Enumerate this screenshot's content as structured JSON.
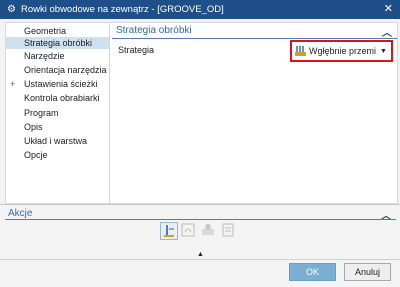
{
  "window": {
    "title": "Rowki obwodowe na zewnątrz - [GROOVE_OD]"
  },
  "tree": {
    "items": [
      {
        "label": "Geometria",
        "selected": false,
        "expandable": false
      },
      {
        "label": "Strategia obróbki",
        "selected": true,
        "expandable": false
      },
      {
        "label": "Narzędzie",
        "selected": false,
        "expandable": false
      },
      {
        "label": "Orientacja narzędzia",
        "selected": false,
        "expandable": false
      },
      {
        "label": "Ustawienia ścieżki",
        "selected": false,
        "expandable": true
      },
      {
        "label": "Kontrola obrabiarki",
        "selected": false,
        "expandable": false
      },
      {
        "label": "Program",
        "selected": false,
        "expandable": false
      },
      {
        "label": "Opis",
        "selected": false,
        "expandable": false
      },
      {
        "label": "Układ i warstwa",
        "selected": false,
        "expandable": false
      },
      {
        "label": "Opcje",
        "selected": false,
        "expandable": false
      }
    ]
  },
  "panel": {
    "title": "Strategia obróbki",
    "field_label": "Strategia",
    "strategy_value": "Wgłębnie przemi",
    "highlight_color": "#e0101b"
  },
  "actions": {
    "title": "Akcje"
  },
  "buttons": {
    "ok": "OK",
    "cancel": "Anuluj"
  },
  "colors": {
    "titlebar": "#1e4f88",
    "accent": "#2e6da4",
    "selection": "#cfe0ee"
  }
}
